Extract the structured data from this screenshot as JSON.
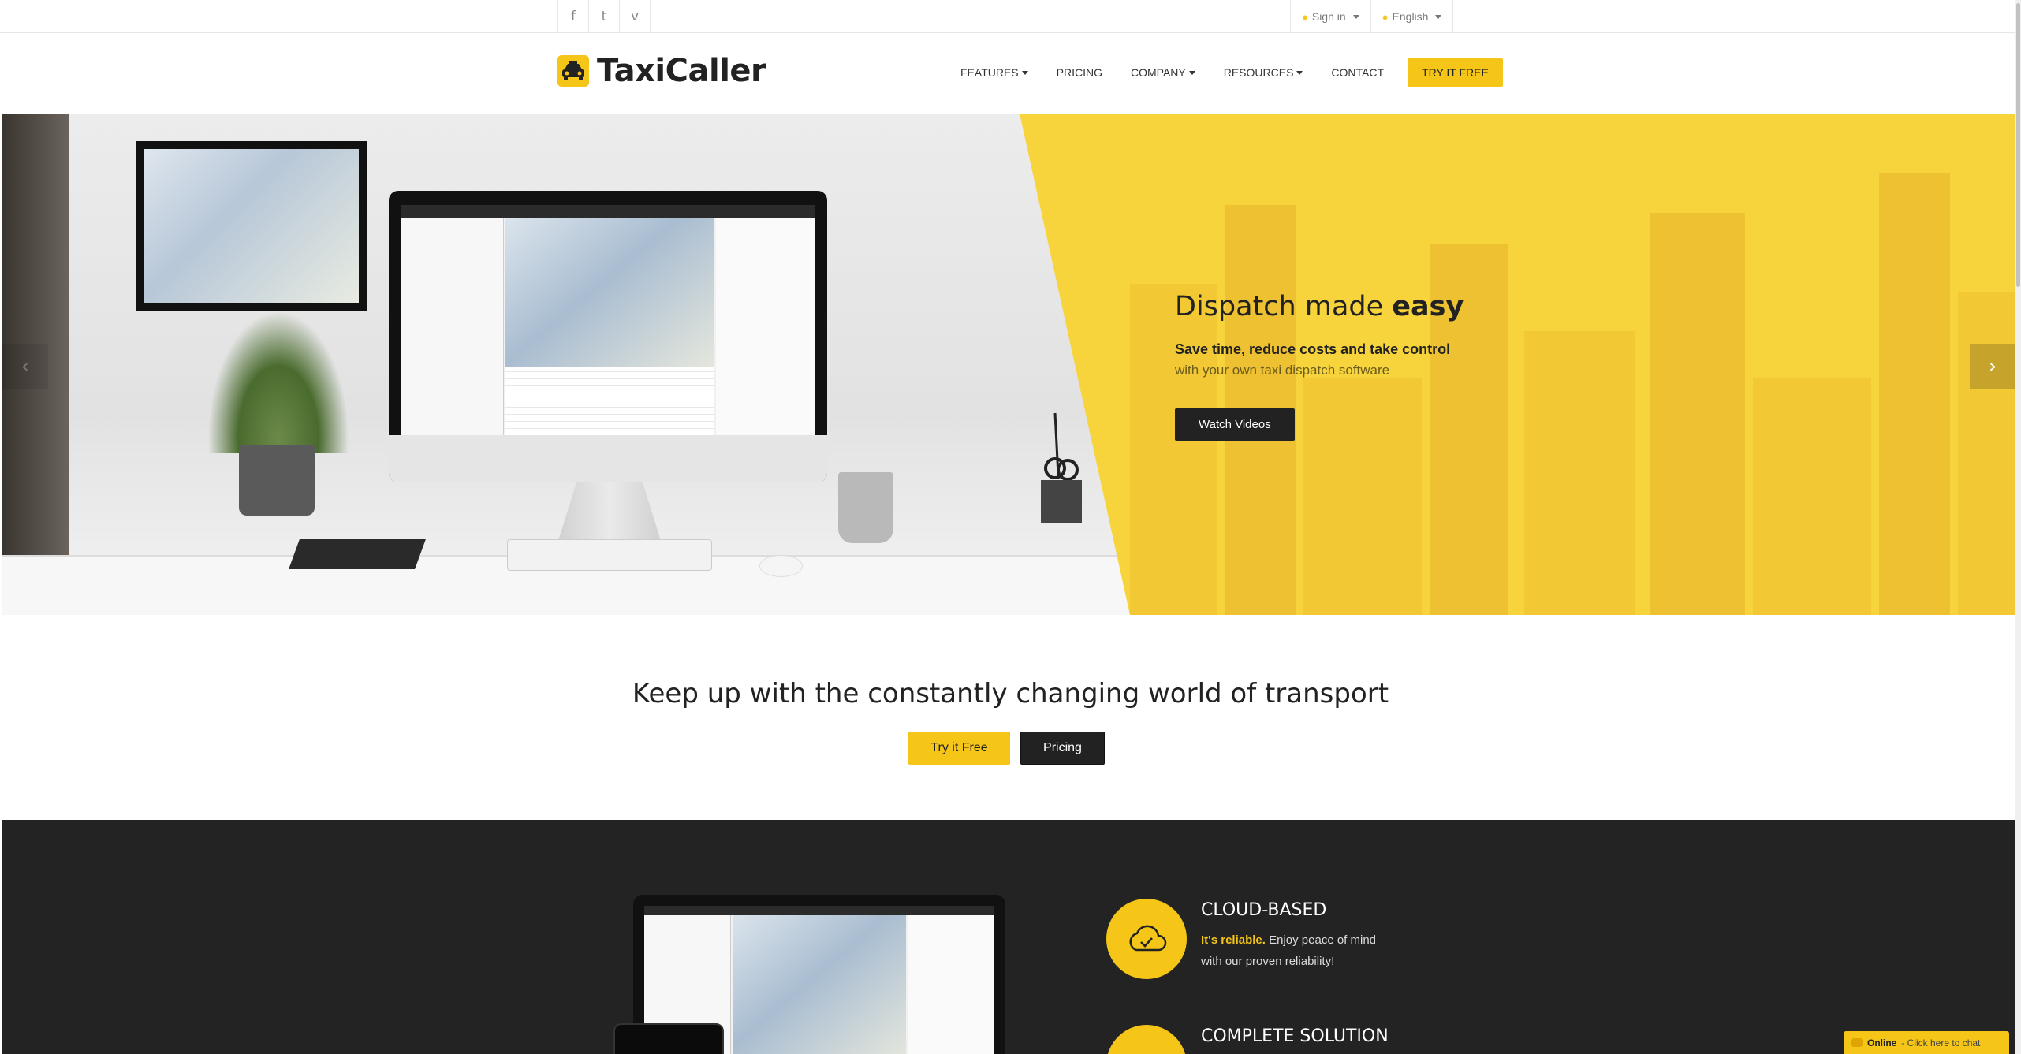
{
  "topbar": {
    "social": [
      {
        "icon": "facebook-icon",
        "glyph": "f"
      },
      {
        "icon": "twitter-icon",
        "glyph": "t"
      },
      {
        "icon": "vimeo-icon",
        "glyph": "v"
      }
    ],
    "sign_in": "Sign in",
    "language": "English"
  },
  "header": {
    "logo_text": "TaxiCaller",
    "nav": [
      "FEATURES",
      "PRICING",
      "COMPANY",
      "RESOURCES",
      "CONTACT"
    ],
    "try_free": "TRY IT FREE"
  },
  "hero": {
    "title_light": "Dispatch made ",
    "title_bold": "easy",
    "subtitle": "Save time, reduce costs and take control",
    "subtitle2": "with your own taxi dispatch software",
    "button": "Watch Videos",
    "prev_arrow": "‹",
    "next_arrow": "›"
  },
  "tagline": {
    "text": "Keep up with the constantly changing world of transport",
    "try_label": "Try it Free",
    "pricing_label": "Pricing"
  },
  "features": [
    {
      "title": "CLOUD-BASED",
      "highlight": "It's reliable.",
      "text": " Enjoy peace of mind with our proven reliability!",
      "icon": "cloud-check-icon"
    },
    {
      "title": "COMPLETE SOLUTION",
      "highlight": "",
      "text": "",
      "icon": "complete-solution-icon"
    }
  ],
  "chat": {
    "status": "Online",
    "text": " - Click here to chat"
  },
  "colors": {
    "accent": "#f5c518",
    "dark": "#232323"
  }
}
